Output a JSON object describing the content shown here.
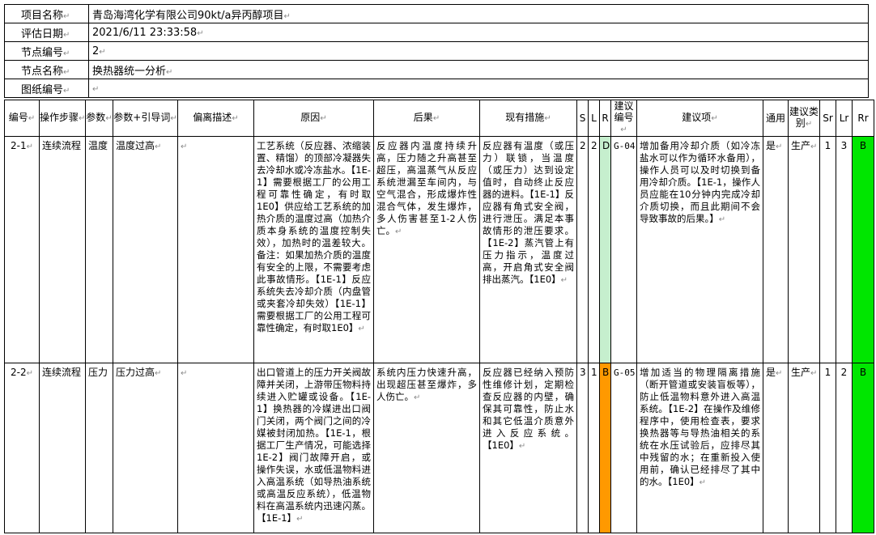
{
  "meta": {
    "rows": [
      {
        "label": "项目名称",
        "value": "青岛海湾化学有限公司90kt/a异丙醇项目"
      },
      {
        "label": "评估日期",
        "value": "2021/6/11 23:33:58"
      },
      {
        "label": "节点编号",
        "value": "2"
      },
      {
        "label": "节点名称",
        "value": "换热器统一分析"
      },
      {
        "label": "图纸编号",
        "value": ""
      }
    ]
  },
  "table": {
    "headers": [
      "编号",
      "操作步骤",
      "参数",
      "参数+引导词",
      "偏离描述",
      "原因",
      "后果",
      "现有措施",
      "S",
      "L",
      "R",
      "建议编号",
      "建议项",
      "通用",
      "建议类别",
      "Sr",
      "Lr",
      "Rr"
    ],
    "rows": [
      {
        "id": "2-1",
        "step": "连续流程",
        "param": "温度",
        "guide": "温度过高",
        "deviation": "",
        "cause": "工艺系统（反应器、浓缩装置、精馏）的顶部冷凝器失去冷却水或冷冻盐水。【1E-1】需要根据工厂的公用工程可靠性确定，有时取1E0】供应给工艺系统的加热介质的温度过高（加热介质本身系统的温度控制失效），加热时的温差较大。备注：如果加热介质的温度有安全的上限，不需要考虑此事故情形。【1E-1】反应系统失去冷却介质（内盘管或夹套冷却失效）【1E-1】需要根据工厂的公用工程可靠性确定，有时取1E0】",
        "consequence": "反应器内温度持续升高，压力随之升高甚至超压，高温蒸气从反应系统泄漏至车间内，与空气混合，形成爆炸性混合气体，发生爆炸，多人伤害甚至1-2人伤亡。",
        "measures": "反应器有温度（或压力）联锁，当温度（或压力）达到设定值时，自动终止反应器的进料。【1E-1】反应器有角式安全阀，进行泄压。满足本事故情形的泄压要求。【1E-2】蒸汽管上有压力指示，温度过高，开启角式安全阀排出蒸汽。【1E0】",
        "s": "2",
        "l": "2",
        "r": "D",
        "rec_id": "G-04",
        "recommendation": "增加备用冷却介质（如冷冻盐水可以作为循环水备用），操作人员可以及时切换到备用冷却介质。【1E-1，操作人员应能在10分钟内完成冷却介质切换，而且此期间不会导致事故的后果。】",
        "general": "是",
        "category": "生产",
        "sr": "1",
        "lr": "3",
        "rr": "B",
        "r_color": "#c6efce",
        "rr_color": "#00e600"
      },
      {
        "id": "2-2",
        "step": "连续流程",
        "param": "压力",
        "guide": "压力过高",
        "deviation": "",
        "cause": "出口管道上的压力开关阀故障并关闭，上游带压物料持续进入贮罐或设备。【1E-1】换热器的冷媒进出口阀门关闭，两个阀门之间的冷媒被封闭加热。【1E-1，根据工厂生产情况，可能选择1E-2】阀门故障开启，或操作失误，水或低温物料进入高温系统（如导热油系统或高温反应系统），低温物料在高温系统内迅速闪蒸。【1E-1】",
        "consequence": "系统内压力快速升高，出现超压甚至爆炸，多人伤亡。",
        "measures": "反应器已经纳入预防性维修计划，定期检查反应器的内壁，确保其可靠性，防止水和其它低温介质意外进入反应系统。【1E0】",
        "s": "3",
        "l": "1",
        "r": "B",
        "rec_id": "G-05",
        "recommendation": "增加适当的物理隔离措施（断开管道或安装盲板等），防止低温物料意外进入高温系统。【1E-2】在操作及维修程序中，使用检查表，要求换热器等与导热油相关的系统在水压试验后，应排尽其中残留的水；在重新投入使用前，确认已经排尽了其中的水。【1E0】",
        "general": "是",
        "category": "生产",
        "sr": "1",
        "lr": "2",
        "rr": "B",
        "r_color": "#ff9900",
        "rr_color": "#00e600"
      }
    ]
  }
}
